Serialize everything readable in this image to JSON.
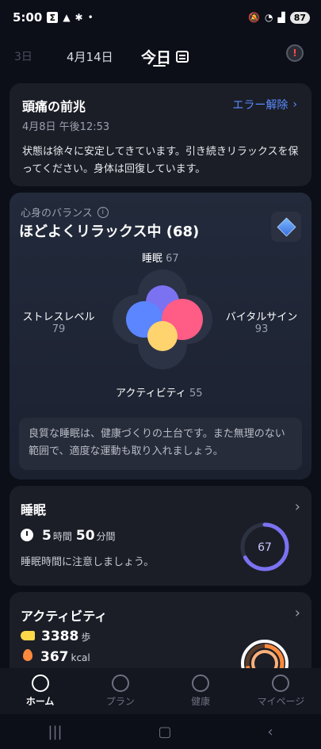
{
  "status": {
    "time": "5:00",
    "battery": "87"
  },
  "date_nav": {
    "prev": "3日",
    "yesterday": "4月14日",
    "today": "今日"
  },
  "alert_card": {
    "title": "頭痛の前兆",
    "link": "エラー解除",
    "timestamp": "4月8日 午後12:53",
    "body": "状態は徐々に安定してきています。引き続きリラックスを保ってください。身体は回復しています。"
  },
  "balance_card": {
    "label": "心身のバランス",
    "state": "ほどよくリラックス中 (68)",
    "sleep": {
      "label": "睡眠",
      "value": "67"
    },
    "stress": {
      "label": "ストレスレベル",
      "value": "79"
    },
    "vital": {
      "label": "バイタルサイン",
      "value": "93"
    },
    "activity": {
      "label": "アクティビティ",
      "value": "55"
    },
    "tip": "良質な睡眠は、健康づくりの土台です。また無理のない範囲で、適度な運動も取り入れましょう。"
  },
  "sleep_card": {
    "title": "睡眠",
    "hours": "5",
    "hours_unit": "時間",
    "minutes": "50",
    "minutes_unit": "分間",
    "note": "睡眠時間に注意しましょう。",
    "score": "67",
    "score_fraction": 0.67
  },
  "activity_card": {
    "title": "アクティビティ",
    "steps": "3388",
    "steps_unit": "歩",
    "kcal": "367",
    "kcal_unit": "kcal"
  },
  "tabs": [
    {
      "label": "ホーム",
      "active": true
    },
    {
      "label": "プラン",
      "active": false
    },
    {
      "label": "健康",
      "active": false
    },
    {
      "label": "マイページ",
      "active": false
    }
  ],
  "colors": {
    "sleep": "#7b72f2",
    "stress": "#5b86ff",
    "vital": "#ff5c86",
    "activity": "#ffd36e",
    "accent": "#5b8cff"
  }
}
